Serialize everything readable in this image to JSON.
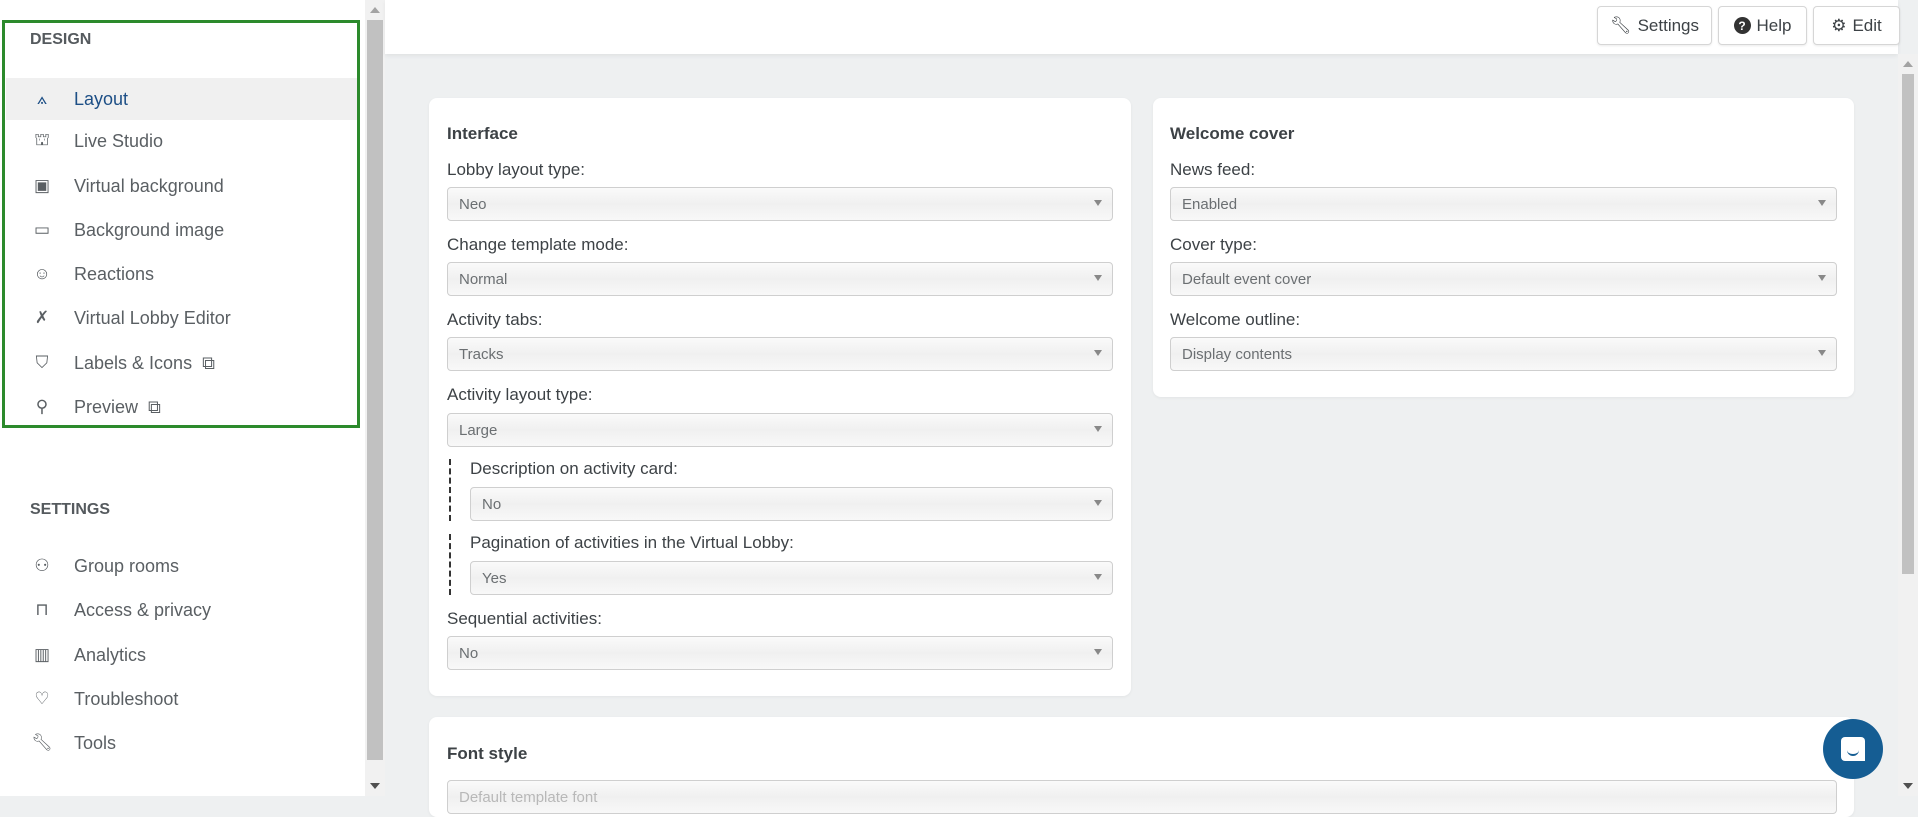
{
  "sidebar": {
    "design_heading": "DESIGN",
    "design_items": [
      {
        "label": "Layout",
        "icon": "compass-drafting-icon",
        "active": true
      },
      {
        "label": "Live Studio",
        "icon": "podium-icon"
      },
      {
        "label": "Virtual background",
        "icon": "id-badge-icon"
      },
      {
        "label": "Background image",
        "icon": "image-icon"
      },
      {
        "label": "Reactions",
        "icon": "smile-chat-icon"
      },
      {
        "label": "Virtual Lobby Editor",
        "icon": "pencil-ruler-icon"
      },
      {
        "label": "Labels & Icons",
        "icon": "marker-icon",
        "external": true
      },
      {
        "label": "Preview",
        "icon": "search-icon",
        "external": true
      }
    ],
    "settings_heading": "SETTINGS",
    "settings_items": [
      {
        "label": "Group rooms",
        "icon": "group-icon"
      },
      {
        "label": "Access & privacy",
        "icon": "door-icon"
      },
      {
        "label": "Analytics",
        "icon": "chart-icon"
      },
      {
        "label": "Troubleshoot",
        "icon": "heart-pulse-icon"
      },
      {
        "label": "Tools",
        "icon": "wrench-icon"
      }
    ]
  },
  "toolbar": {
    "settings": "Settings",
    "help": "Help",
    "edit": "Edit"
  },
  "interface": {
    "title": "Interface",
    "fields": [
      {
        "label": "Lobby layout type:",
        "value": "Neo"
      },
      {
        "label": "Change template mode:",
        "value": "Normal"
      },
      {
        "label": "Activity tabs:",
        "value": "Tracks"
      },
      {
        "label": "Activity layout type:",
        "value": "Large"
      },
      {
        "label": "Description on activity card:",
        "value": "No"
      },
      {
        "label": "Pagination of activities in the Virtual Lobby:",
        "value": "Yes"
      },
      {
        "label": "Sequential activities:",
        "value": "No"
      }
    ]
  },
  "welcome": {
    "title": "Welcome cover",
    "fields": [
      {
        "label": "News feed:",
        "value": "Enabled"
      },
      {
        "label": "Cover type:",
        "value": "Default event cover"
      },
      {
        "label": "Welcome outline:",
        "value": "Display contents"
      }
    ]
  },
  "font_style": {
    "title": "Font style",
    "value": "Default template font"
  },
  "colors": {
    "accent": "#1d4f86",
    "highlight": "#2c8a2c",
    "chat": "#155d93"
  }
}
